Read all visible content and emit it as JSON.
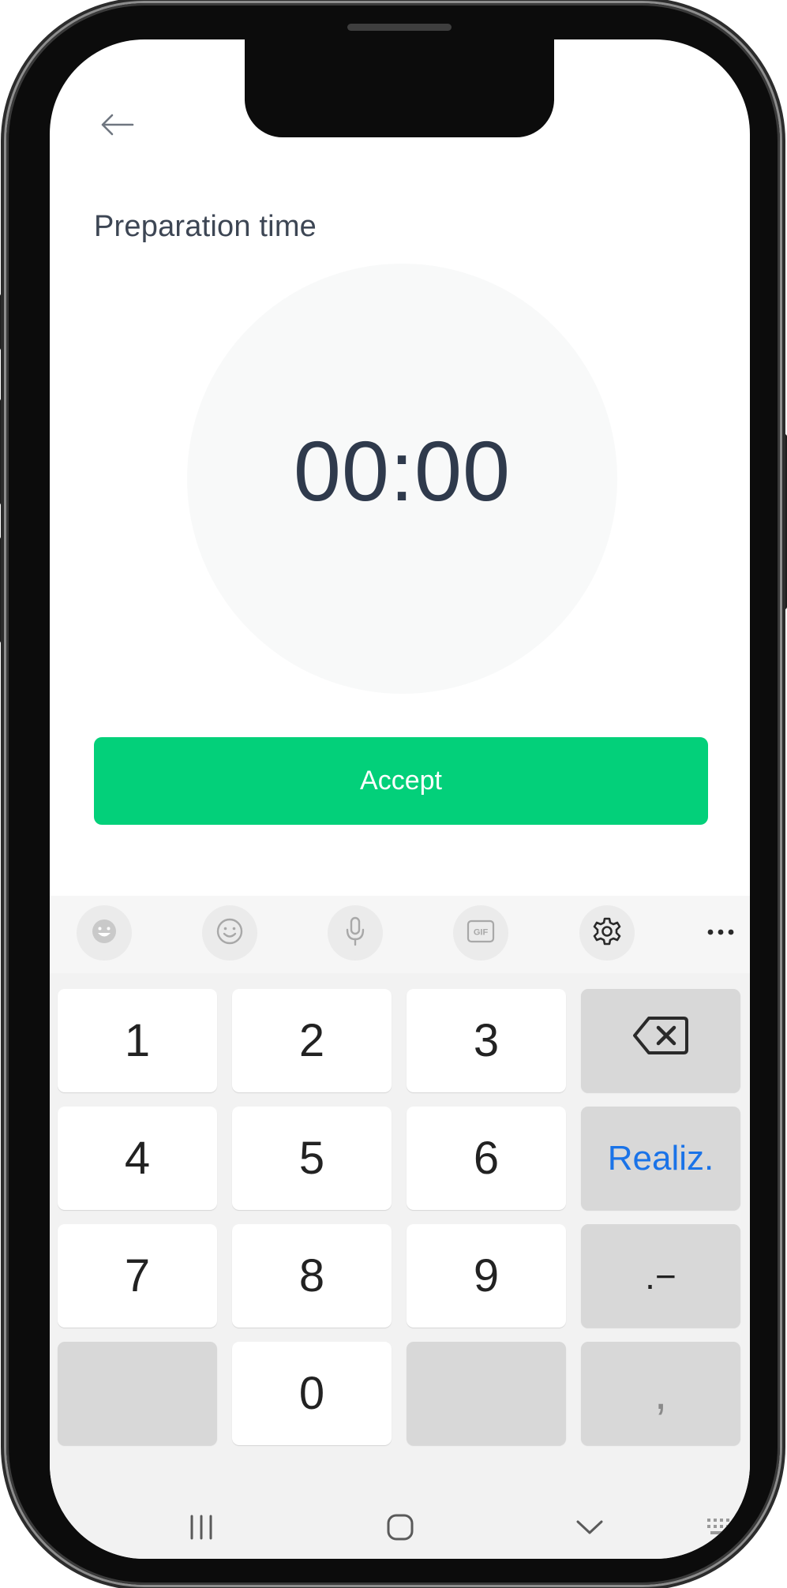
{
  "header": {
    "title": "Preparation time"
  },
  "timer": {
    "value": "00:00"
  },
  "actions": {
    "accept_label": "Accept"
  },
  "keyboard": {
    "toolbar": [
      "sticker-icon",
      "emoji-icon",
      "microphone-icon",
      "gif-icon",
      "settings-icon",
      "more-icon"
    ],
    "gif_label": "GIF",
    "keys": {
      "k1": "1",
      "k2": "2",
      "k3": "3",
      "k4": "4",
      "k5": "5",
      "k6": "6",
      "k7": "7",
      "k8": "8",
      "k9": "9",
      "k0": "0",
      "done": "Realiz.",
      "dot_dash": ".−",
      "comma": ","
    }
  },
  "colors": {
    "accent": "#03d07a",
    "title_text": "#3d4654",
    "timer_text": "#2f3a4c",
    "done_key_text": "#1a73e8"
  }
}
